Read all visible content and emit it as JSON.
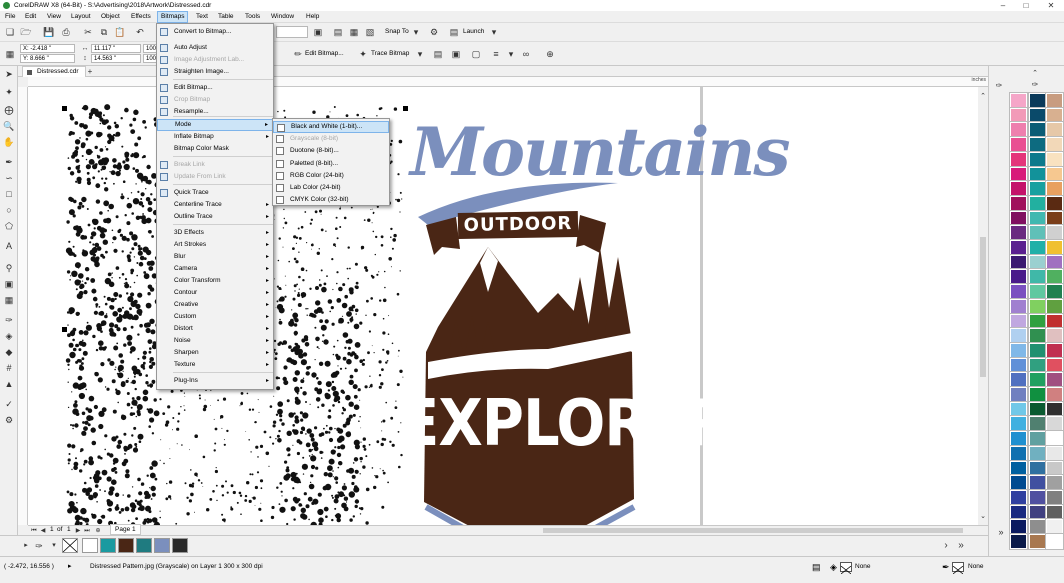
{
  "app": {
    "title": "CorelDRAW X8 (64-Bit) - S:\\Advertising\\2018\\Artwork\\Distressed.cdr"
  },
  "menubar": [
    "File",
    "Edit",
    "View",
    "Layout",
    "Object",
    "Effects",
    "Bitmaps",
    "Text",
    "Table",
    "Tools",
    "Window",
    "Help"
  ],
  "toolbar": {
    "x_field": "X: -2.418 \"",
    "y_field": "Y: 8.666 \"",
    "width_field": "11.117 \"",
    "height_field": "14.563 \"",
    "scale_w": "100.",
    "scale_h": "100.",
    "snap_to": "Snap To",
    "launch": "Launch",
    "edit_bitmap": "Edit Bitmap...",
    "trace_bitmap": "Trace Bitmap"
  },
  "document": {
    "tab": "Distressed.cdr",
    "ruler_unit": "inches"
  },
  "bitmaps_menu": [
    {
      "label": "Convert to Bitmap...",
      "disabled": false,
      "icon": true
    },
    {
      "label": "Auto Adjust",
      "disabled": false,
      "icon": true
    },
    {
      "label": "Image Adjustment Lab...",
      "disabled": true,
      "icon": true
    },
    {
      "label": "Straighten Image...",
      "disabled": false,
      "icon": true
    },
    {
      "label": "Edit Bitmap...",
      "disabled": false,
      "icon": true
    },
    {
      "label": "Crop Bitmap",
      "disabled": true,
      "icon": true
    },
    {
      "label": "Resample...",
      "disabled": false,
      "icon": true
    },
    {
      "label": "Mode",
      "disabled": false,
      "submenu": true
    },
    {
      "label": "Inflate Bitmap",
      "disabled": false,
      "submenu": true
    },
    {
      "label": "Bitmap Color Mask",
      "disabled": false
    },
    {
      "label": "Break Link",
      "disabled": true,
      "icon": true
    },
    {
      "label": "Update From Link",
      "disabled": true,
      "icon": true
    },
    {
      "label": "Quick Trace",
      "disabled": false,
      "icon": true
    },
    {
      "label": "Centerline Trace",
      "disabled": false,
      "submenu": true
    },
    {
      "label": "Outline Trace",
      "disabled": false,
      "submenu": true
    },
    {
      "label": "3D Effects",
      "disabled": false,
      "submenu": true
    },
    {
      "label": "Art Strokes",
      "disabled": false,
      "submenu": true
    },
    {
      "label": "Blur",
      "disabled": false,
      "submenu": true
    },
    {
      "label": "Camera",
      "disabled": false,
      "submenu": true
    },
    {
      "label": "Color Transform",
      "disabled": false,
      "submenu": true
    },
    {
      "label": "Contour",
      "disabled": false,
      "submenu": true
    },
    {
      "label": "Creative",
      "disabled": false,
      "submenu": true
    },
    {
      "label": "Custom",
      "disabled": false,
      "submenu": true
    },
    {
      "label": "Distort",
      "disabled": false,
      "submenu": true
    },
    {
      "label": "Noise",
      "disabled": false,
      "submenu": true
    },
    {
      "label": "Sharpen",
      "disabled": false,
      "submenu": true
    },
    {
      "label": "Texture",
      "disabled": false,
      "submenu": true
    },
    {
      "label": "Plug-Ins",
      "disabled": false,
      "submenu": true
    }
  ],
  "mode_submenu": [
    {
      "label": "Black and White (1-bit)...",
      "disabled": false
    },
    {
      "label": "Grayscale (8-bit)",
      "disabled": true
    },
    {
      "label": "Duotone (8-bit)...",
      "disabled": false
    },
    {
      "label": "Paletted (8-bit)...",
      "disabled": false
    },
    {
      "label": "RGB Color (24-bit)",
      "disabled": false
    },
    {
      "label": "Lab Color (24-bit)",
      "disabled": false
    },
    {
      "label": "CMYK Color (32-bit)",
      "disabled": false
    }
  ],
  "artwork": {
    "title": "Mountains",
    "ribbon": "OUTDOOR",
    "footer": "EXPLORER",
    "colors": {
      "title": "#7b8fbd",
      "brown": "#4a2615"
    }
  },
  "page_nav": {
    "current": "1",
    "of": "of",
    "total": "1",
    "page_tab": "Page 1"
  },
  "doc_palette": [
    "#ffffff",
    "#1a9aa0",
    "#4a2615",
    "#1f7b80",
    "#7b8fbd",
    "#2a2a2a"
  ],
  "color_palette": [
    [
      "#f5a6c8",
      "#0a3a5a",
      "#c89c80"
    ],
    [
      "#f29ab8",
      "#0a4a6a",
      "#d8b090"
    ],
    [
      "#ee7fae",
      "#0b5c75",
      "#e6c8a8"
    ],
    [
      "#e94f92",
      "#0d6b80",
      "#f2d8b8"
    ],
    [
      "#e4357a",
      "#0e7a8c",
      "#f9e2c0"
    ],
    [
      "#d81b7a",
      "#12929a",
      "#f6c890"
    ],
    [
      "#c4126a",
      "#19a0a0",
      "#e8a060"
    ],
    [
      "#a0105c",
      "#22b0a0",
      "#5a2a12"
    ],
    [
      "#801060",
      "#40b8b0",
      "#7a3e1a"
    ],
    [
      "#6a2a80",
      "#60c0b8",
      "#d0d0d0"
    ],
    [
      "#5a2090",
      "#20b0a8",
      "#f0c030"
    ],
    [
      "#3a1a70",
      "#9ad0d0",
      "#a070c0"
    ],
    [
      "#4a1a8a",
      "#40b8a8",
      "#50b060"
    ],
    [
      "#7a50c0",
      "#60c8a0",
      "#208050"
    ],
    [
      "#a080d0",
      "#80d060",
      "#60a040"
    ],
    [
      "#c0a8e0",
      "#30a040",
      "#c03030"
    ],
    [
      "#b0d0f0",
      "#309050",
      "#e0c0c0"
    ],
    [
      "#80b8e8",
      "#209070",
      "#c03050"
    ],
    [
      "#6090d8",
      "#30a080",
      "#e05060"
    ],
    [
      "#5070c0",
      "#20a060",
      "#a05080"
    ],
    [
      "#7080c0",
      "#109040",
      "#d08080"
    ],
    [
      "#70c8e8",
      "#0a5a30",
      "#303030"
    ],
    [
      "#40b0e0",
      "#508070",
      "#d8d8d8"
    ],
    [
      "#2090d0",
      "#60a0a0",
      "#ffffff"
    ],
    [
      "#1070b0",
      "#70b0c0",
      "#e8e8e8"
    ],
    [
      "#0060a0",
      "#3070a0",
      "#c8c8c8"
    ],
    [
      "#004a90",
      "#4050a0",
      "#a0a0a0"
    ],
    [
      "#3040a0",
      "#5050a0",
      "#808080"
    ],
    [
      "#1a2a80",
      "#404080",
      "#606060"
    ],
    [
      "#0a1a60",
      "#8e8e8e",
      "#f0f0f0"
    ],
    [
      "#0a1a4a",
      "#a87850",
      "#ffffff"
    ]
  ],
  "status": {
    "coords": "( -2.472, 16.556 )",
    "object_info": "Distressed Pattern.jpg (Grayscale) on Layer 1 300 x 300 dpi",
    "fill": "None",
    "outline": "None"
  }
}
